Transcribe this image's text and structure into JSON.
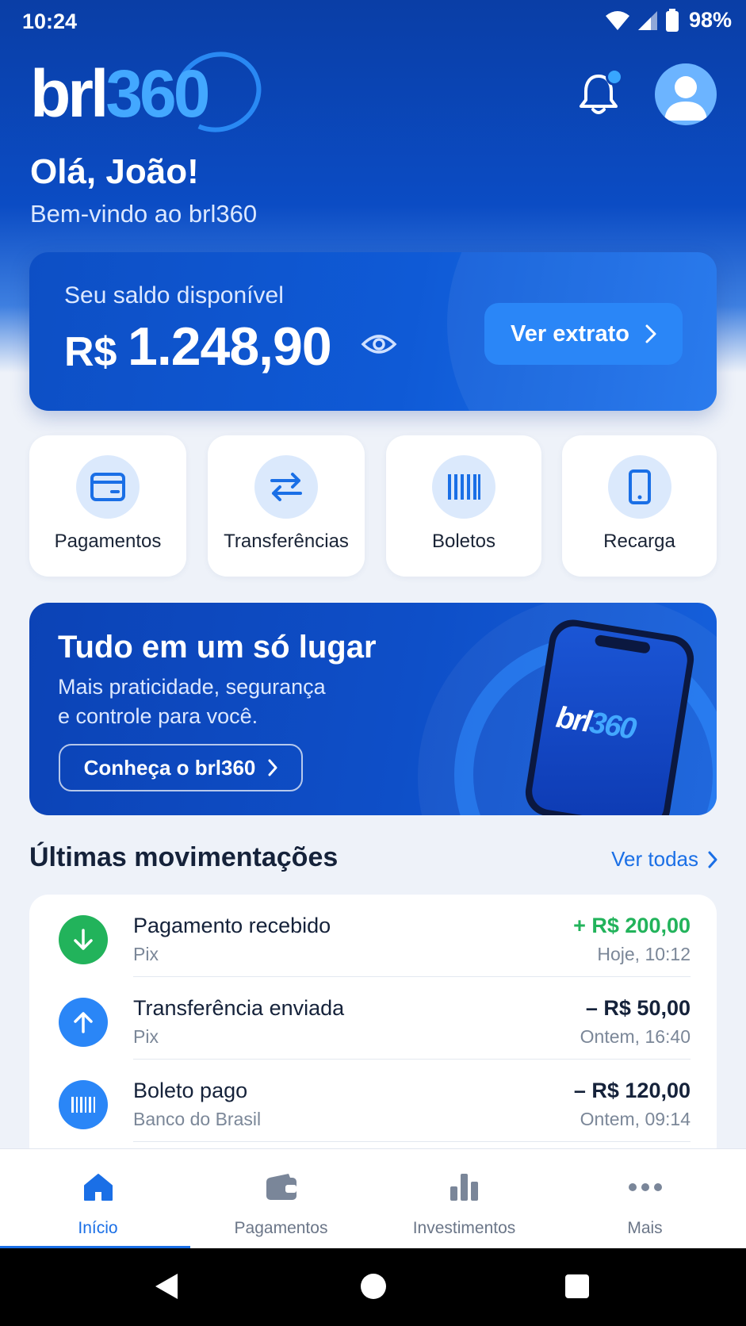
{
  "status": {
    "time": "10:24",
    "battery": "98%"
  },
  "brand": {
    "prefix": "brl",
    "suffix": "360"
  },
  "greeting": {
    "title": "Olá, João!",
    "subtitle": "Bem-vindo ao brl360"
  },
  "balance": {
    "label": "Seu saldo disponível",
    "currency": "R$",
    "amount": "1.248,90",
    "statement_button": "Ver extrato"
  },
  "quick_actions": [
    {
      "label": "Pagamentos",
      "icon": "card-icon"
    },
    {
      "label": "Transferências",
      "icon": "transfer-arrows-icon"
    },
    {
      "label": "Boletos",
      "icon": "barcode-icon"
    },
    {
      "label": "Recarga",
      "icon": "phone-icon"
    }
  ],
  "promo": {
    "title": "Tudo em um só lugar",
    "subtitle_line1": "Mais praticidade, segurança",
    "subtitle_line2": "e controle para você.",
    "button": "Conheça o brl360"
  },
  "transactions_section": {
    "title": "Últimas movimentações",
    "see_all": "Ver todas"
  },
  "transactions": [
    {
      "name": "Pagamento recebido",
      "sub": "Pix",
      "amount": "+ R$ 200,00",
      "date": "Hoje, 10:12",
      "icon": "arrow-down-icon",
      "color": "#22b35b"
    },
    {
      "name": "Transferência enviada",
      "sub": "Pix",
      "amount": "– R$ 50,00",
      "date": "Ontem, 16:40",
      "icon": "arrow-up-icon",
      "color": "#2a86f7"
    },
    {
      "name": "Boleto pago",
      "sub": "Banco do Brasil",
      "amount": "– R$ 120,00",
      "date": "Ontem, 09:14",
      "icon": "barcode-icon",
      "color": "#2a86f7"
    }
  ],
  "nav": [
    {
      "label": "Início",
      "icon": "home-icon",
      "active": true
    },
    {
      "label": "Pagamentos",
      "icon": "wallet-icon",
      "active": false
    },
    {
      "label": "Investimentos",
      "icon": "bar-chart-icon",
      "active": false
    },
    {
      "label": "Mais",
      "icon": "more-icon",
      "active": false
    }
  ],
  "colors": {
    "primary": "#0b4cc4",
    "accent": "#1a6fe6",
    "positive": "#22b35b"
  }
}
